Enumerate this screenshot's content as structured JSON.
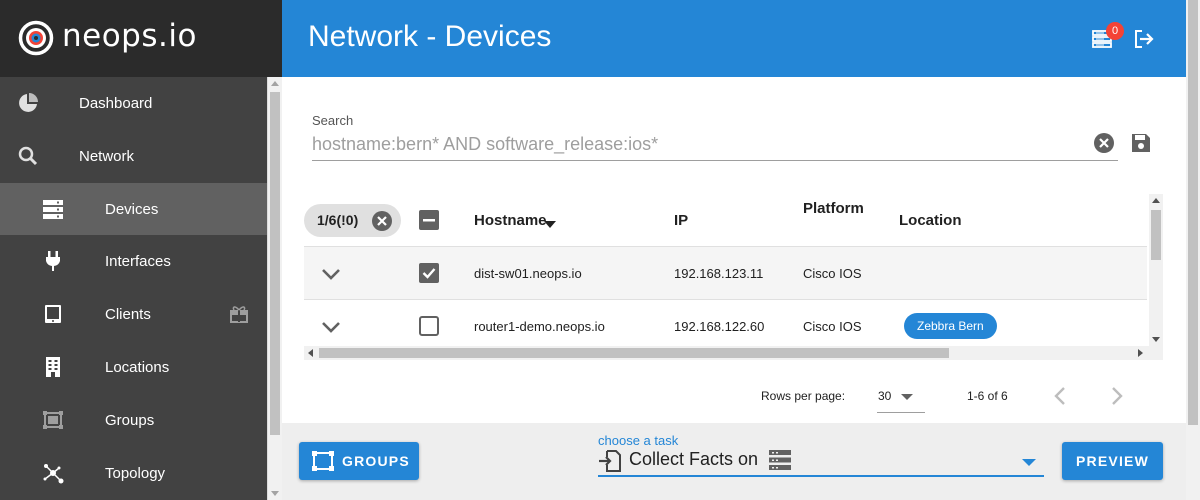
{
  "app": {
    "logo_text": "neops.io"
  },
  "sidebar": {
    "items": [
      {
        "label": "Dashboard",
        "icon": "pie-chart-icon"
      },
      {
        "label": "Network",
        "icon": "search-icon"
      },
      {
        "label": "Devices",
        "icon": "server-icon",
        "active": true
      },
      {
        "label": "Interfaces",
        "icon": "plug-icon"
      },
      {
        "label": "Clients",
        "icon": "tablet-icon",
        "extra_icon": "gift-icon"
      },
      {
        "label": "Locations",
        "icon": "building-icon"
      },
      {
        "label": "Groups",
        "icon": "group-icon"
      },
      {
        "label": "Topology",
        "icon": "topology-icon"
      }
    ]
  },
  "header": {
    "title": "Network - Devices",
    "notification_count": "0",
    "icons": [
      "task-list-icon",
      "logout-icon"
    ]
  },
  "search": {
    "label": "Search",
    "value": "hostname:bern* AND software_release:ios*"
  },
  "table": {
    "selection_chip": "1/6(!0)",
    "columns": [
      "Hostname",
      "IP",
      "Platform",
      "Location"
    ],
    "sort_column": "Hostname",
    "rows": [
      {
        "hostname": "dist-sw01.neops.io",
        "ip": "192.168.123.11",
        "platform": "Cisco IOS",
        "location": "",
        "checked": true
      },
      {
        "hostname": "router1-demo.neops.io",
        "ip": "192.168.122.60",
        "platform": "Cisco IOS",
        "location": "Zebbra Bern",
        "checked": false
      }
    ]
  },
  "pagination": {
    "rows_per_page_label": "Rows per page:",
    "rows_per_page": "30",
    "range": "1-6 of 6"
  },
  "footer": {
    "groups_button": "GROUPS",
    "task_label": "choose a task",
    "task_value": "Collect Facts on",
    "preview_button": "PREVIEW"
  },
  "colors": {
    "primary": "#2486d6",
    "sidebar_bg": "#424242",
    "sidebar_active": "#616161",
    "logo_bg": "#2b2b2b",
    "logo_accent": "#f44336",
    "badge": "#f44336"
  }
}
